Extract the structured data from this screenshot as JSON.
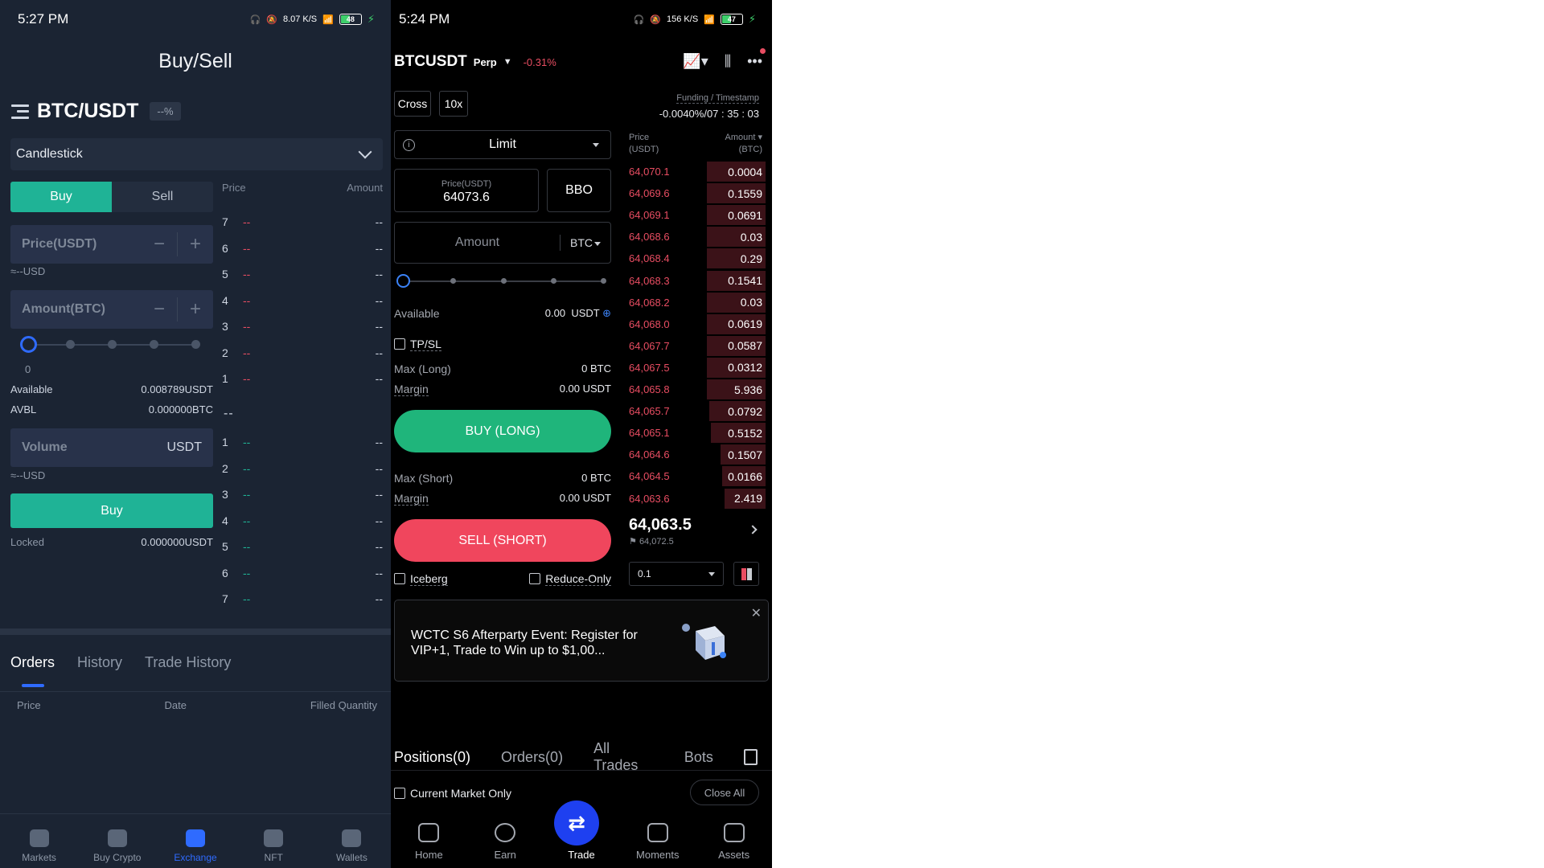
{
  "left": {
    "status": {
      "time": "5:27 PM",
      "speed": "8.07 K/S",
      "battery": "48",
      "battery_fraction": 0.48
    },
    "title": "Buy/Sell",
    "pair": "BTC/USDT",
    "change": "--%",
    "chart_type": "Candlestick",
    "tabs": {
      "buy": "Buy",
      "sell": "Sell"
    },
    "price_label": "Price(USDT)",
    "price_usd": "≈--USD",
    "amount_label": "Amount(BTC)",
    "slider_value": "0",
    "available": {
      "label": "Available",
      "value": "0.008789USDT"
    },
    "avbl": {
      "label": "AVBL",
      "value": "0.000000BTC"
    },
    "volume": {
      "label": "Volume",
      "unit": "USDT"
    },
    "volume_usd": "≈--USD",
    "buy_button": "Buy",
    "locked": {
      "label": "Locked",
      "value": "0.000000USDT"
    },
    "book": {
      "price_header": "Price",
      "amount_header": "Amount",
      "asks": [
        {
          "n": "7",
          "p": "--",
          "a": "--"
        },
        {
          "n": "6",
          "p": "--",
          "a": "--"
        },
        {
          "n": "5",
          "p": "--",
          "a": "--"
        },
        {
          "n": "4",
          "p": "--",
          "a": "--"
        },
        {
          "n": "3",
          "p": "--",
          "a": "--"
        },
        {
          "n": "2",
          "p": "--",
          "a": "--"
        },
        {
          "n": "1",
          "p": "--",
          "a": "--"
        }
      ],
      "mid": "--",
      "bids": [
        {
          "n": "1",
          "p": "--",
          "a": "--"
        },
        {
          "n": "2",
          "p": "--",
          "a": "--"
        },
        {
          "n": "3",
          "p": "--",
          "a": "--"
        },
        {
          "n": "4",
          "p": "--",
          "a": "--"
        },
        {
          "n": "5",
          "p": "--",
          "a": "--"
        },
        {
          "n": "6",
          "p": "--",
          "a": "--"
        },
        {
          "n": "7",
          "p": "--",
          "a": "--"
        }
      ]
    },
    "orders_tabs": [
      "Orders",
      "History",
      "Trade History"
    ],
    "orders_cols": [
      "Price",
      "Date",
      "Filled Quantity"
    ],
    "nav": [
      "Markets",
      "Buy Crypto",
      "Exchange",
      "NFT",
      "Wallets"
    ]
  },
  "right": {
    "status": {
      "time": "5:24 PM",
      "speed": "156 K/S",
      "battery": "47",
      "battery_fraction": 0.47
    },
    "symbol": "BTCUSDT",
    "contract": "Perp",
    "change": "-0.31%",
    "margin_mode": "Cross",
    "leverage": "10x",
    "funding_label": "Funding / Timestamp",
    "funding_value": "-0.0040%/07 : 35 : 03",
    "order_type": "Limit",
    "price_label": "Price(USDT)",
    "price_value": "64073.6",
    "bbo": "BBO",
    "amount_placeholder": "Amount",
    "amount_unit": "BTC",
    "available": {
      "label": "Available",
      "value": "0.00",
      "unit": "USDT"
    },
    "tpsl": "TP/SL",
    "max_long": {
      "label": "Max (Long)",
      "value": "0 BTC"
    },
    "margin_long": {
      "label": "Margin",
      "value": "0.00 USDT"
    },
    "buy_button": "BUY (LONG)",
    "max_short": {
      "label": "Max (Short)",
      "value": "0 BTC"
    },
    "margin_short": {
      "label": "Margin",
      "value": "0.00 USDT"
    },
    "sell_button": "SELL (SHORT)",
    "iceberg": "Iceberg",
    "reduce_only": "Reduce-Only",
    "book": {
      "price_header": "Price",
      "price_unit": "(USDT)",
      "amount_header": "Amount",
      "amount_unit": "(BTC)",
      "asks": [
        {
          "p": "64,070.1",
          "q": "0.0004",
          "depth": 0.43
        },
        {
          "p": "64,069.6",
          "q": "0.1559",
          "depth": 0.43
        },
        {
          "p": "64,069.1",
          "q": "0.0691",
          "depth": 0.43
        },
        {
          "p": "64,068.6",
          "q": "0.03",
          "depth": 0.43
        },
        {
          "p": "64,068.4",
          "q": "0.29",
          "depth": 0.43
        },
        {
          "p": "64,068.3",
          "q": "0.1541",
          "depth": 0.43
        },
        {
          "p": "64,068.2",
          "q": "0.03",
          "depth": 0.43
        },
        {
          "p": "64,068.0",
          "q": "0.0619",
          "depth": 0.43
        },
        {
          "p": "64,067.7",
          "q": "0.0587",
          "depth": 0.43
        },
        {
          "p": "64,067.5",
          "q": "0.0312",
          "depth": 0.43
        },
        {
          "p": "64,065.8",
          "q": "5.936",
          "depth": 0.43
        },
        {
          "p": "64,065.7",
          "q": "0.0792",
          "depth": 0.41
        },
        {
          "p": "64,065.1",
          "q": "0.5152",
          "depth": 0.4
        },
        {
          "p": "64,064.6",
          "q": "0.1507",
          "depth": 0.33
        },
        {
          "p": "64,064.5",
          "q": "0.0166",
          "depth": 0.32
        },
        {
          "p": "64,063.6",
          "q": "2.419",
          "depth": 0.3
        }
      ],
      "last_price": "64,063.5",
      "mark_price": "64,072.5",
      "depth_step": "0.1"
    },
    "ad_text": "WCTC S6 Afterparty Event: Register for VIP+1, Trade to Win up to $1,00...",
    "position_tabs": [
      "Positions(0)",
      "Orders(0)",
      "All Trades",
      "Bots"
    ],
    "current_market_only": "Current Market Only",
    "close_all": "Close All",
    "nav": [
      "Home",
      "Earn",
      "Trade",
      "Moments",
      "Assets"
    ],
    "colors": {
      "buy": "#1fb57b",
      "sell": "#f0465d",
      "accent": "#1e40f0"
    }
  }
}
